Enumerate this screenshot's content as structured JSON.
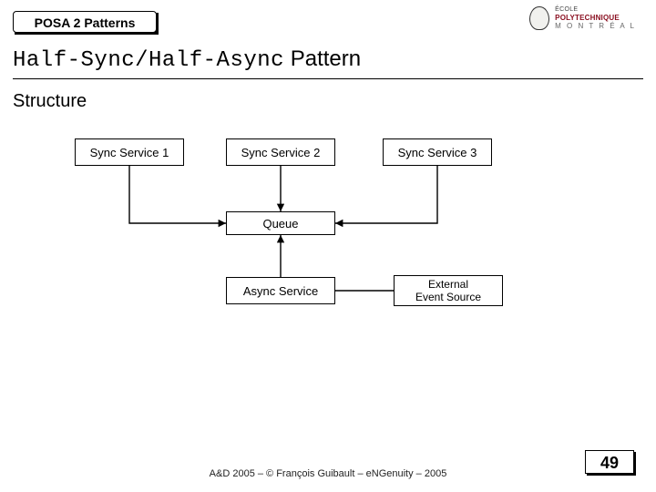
{
  "badge": "POSA 2 Patterns",
  "title_mono": "Half-Sync/Half-Async",
  "title_rest": " Pattern",
  "subhead": "Structure",
  "boxes": {
    "sync1": "Sync Service 1",
    "sync2": "Sync Service 2",
    "sync3": "Sync Service 3",
    "queue": "Queue",
    "async": "Async Service",
    "ext": "External\nEvent Source"
  },
  "logo": {
    "line1": "ÉCOLE",
    "line2": "POLYTECHNIQUE",
    "line3": "M O N T R É A L"
  },
  "footer": "A&D 2005 – ©  François Guibault – eNGenuity – 2005",
  "page": "49"
}
